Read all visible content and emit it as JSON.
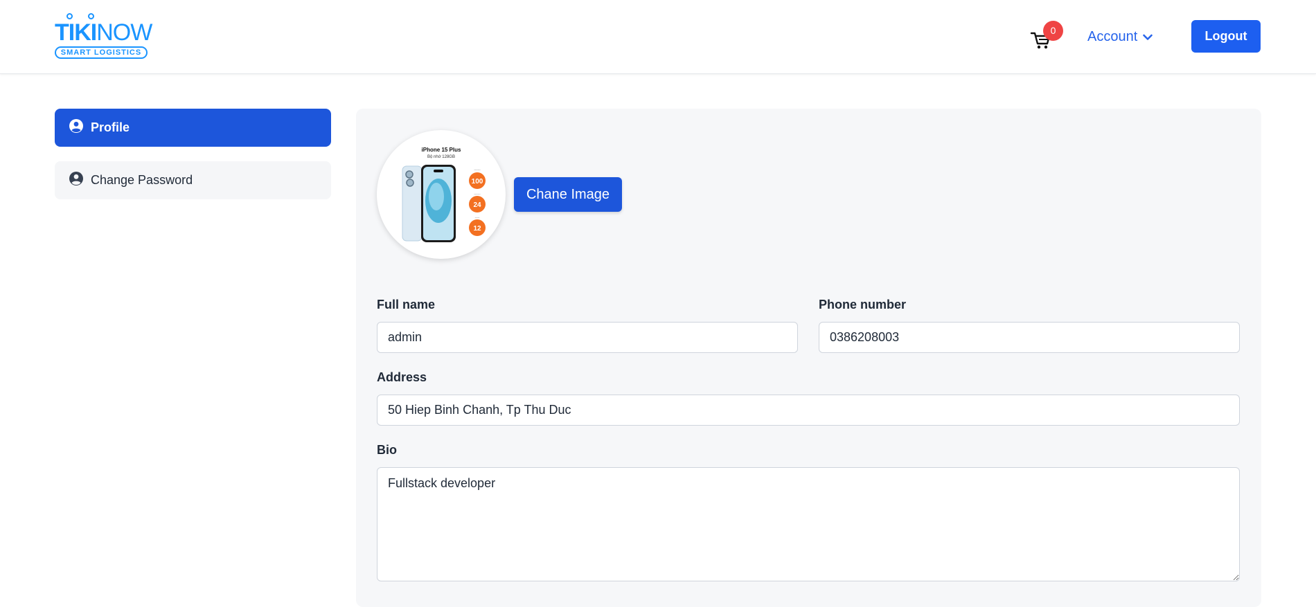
{
  "header": {
    "logo_main_bold": "TIKI",
    "logo_main_light": "NOW",
    "logo_sub": "SMART LOGISTICS",
    "cart_count": "0",
    "account_label": "Account",
    "logout_label": "Logout"
  },
  "sidebar": {
    "items": [
      {
        "label": "Profile",
        "icon": "user-circle-icon",
        "active": true
      },
      {
        "label": "Change Password",
        "icon": "user-circle-icon",
        "active": false
      }
    ]
  },
  "profile": {
    "avatar_product": {
      "title": "iPhone 15 Plus",
      "subtitle": "Bộ nhớ 128GB",
      "badges": [
        "100",
        "24",
        "12"
      ]
    },
    "change_image_label": "Chane Image",
    "full_name_label": "Full name",
    "full_name_value": "admin",
    "phone_label": "Phone number",
    "phone_value": "0386208003",
    "address_label": "Address",
    "address_value": "50 Hiep Binh Chanh, Tp Thu Duc",
    "bio_label": "Bio",
    "bio_value": "Fullstack developer"
  },
  "colors": {
    "primary": "#1d56db",
    "brand": "#1a94ff",
    "badge": "#ef4444",
    "panel_bg": "#f6f7f9"
  }
}
